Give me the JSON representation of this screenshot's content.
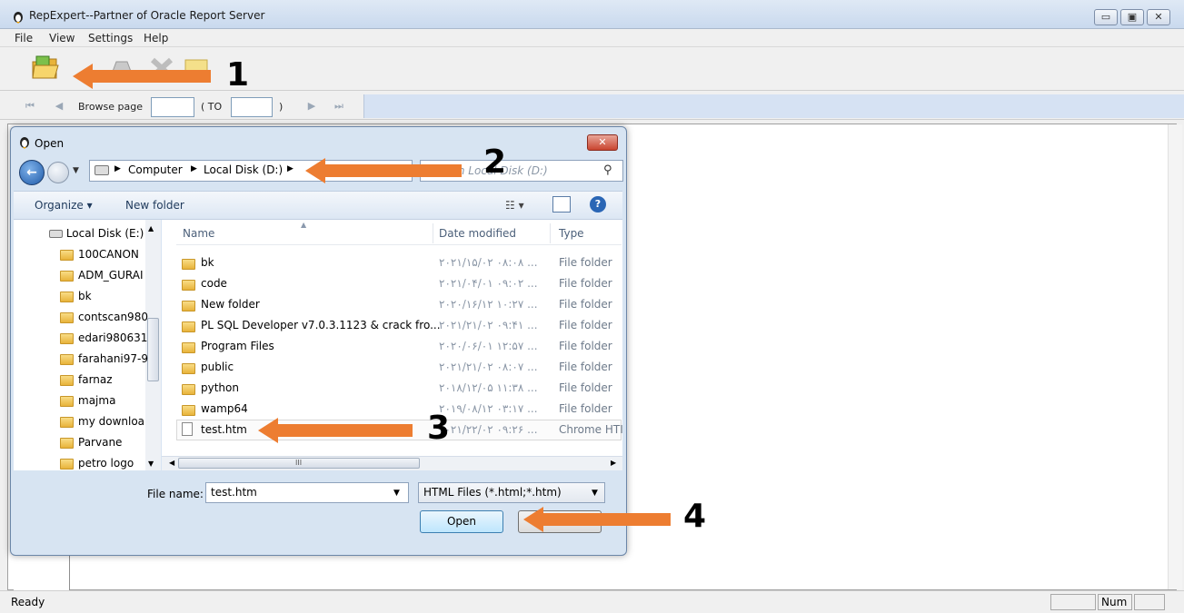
{
  "app": {
    "title": "RepExpert--Partner of Oracle Report Server",
    "window_controls": {
      "minimize": "▭",
      "maximize": "▣",
      "close": "✕"
    }
  },
  "menu": [
    "File",
    "View",
    "Settings",
    "Help"
  ],
  "browse_bar": {
    "label": "Browse page",
    "to_label": "( TO",
    "close_paren": ")"
  },
  "status": {
    "text": "Ready",
    "num": "Num"
  },
  "dialog": {
    "title": "Open",
    "close": "✕",
    "breadcrumb": [
      "Computer",
      "Local Disk (D:)"
    ],
    "search_placeholder": "Search Local Disk (D:)",
    "commands": {
      "organize": "Organize ▾",
      "new_folder": "New folder"
    },
    "nav_items": [
      {
        "label": "Local Disk (E:)",
        "type": "drive"
      },
      {
        "label": "100CANON",
        "type": "folder"
      },
      {
        "label": "ADM_GURAI",
        "type": "folder"
      },
      {
        "label": "bk",
        "type": "folder"
      },
      {
        "label": "contscan980",
        "type": "folder"
      },
      {
        "label": "edari980631",
        "type": "folder"
      },
      {
        "label": "farahani97-9",
        "type": "folder"
      },
      {
        "label": "farnaz",
        "type": "folder"
      },
      {
        "label": "majma",
        "type": "folder"
      },
      {
        "label": "my downloa",
        "type": "folder"
      },
      {
        "label": "Parvane",
        "type": "folder"
      },
      {
        "label": "petro logo",
        "type": "folder"
      }
    ],
    "columns": {
      "name": "Name",
      "date": "Date modified",
      "type": "Type"
    },
    "files": [
      {
        "name": "bk",
        "date": "۲۰۲۱/۱۵/۰۲ ۰۸:۰۸ ...",
        "type": "File folder",
        "kind": "folder"
      },
      {
        "name": "code",
        "date": "۲۰۲۱/۰۴/۰۱ ۰۹:۰۲ ...",
        "type": "File folder",
        "kind": "folder"
      },
      {
        "name": "New folder",
        "date": "۲۰۲۰/۱۶/۱۲ ۱۰:۲۷ ...",
        "type": "File folder",
        "kind": "folder"
      },
      {
        "name": "PL SQL Developer v7.0.3.1123 & crack fro...",
        "date": "۲۰۲۱/۲۱/۰۲ ۰۹:۴۱ ...",
        "type": "File folder",
        "kind": "folder"
      },
      {
        "name": "Program Files",
        "date": "۲۰۲۰/۰۶/۰۱ ۱۲:۵۷ ...",
        "type": "File folder",
        "kind": "folder"
      },
      {
        "name": "public",
        "date": "۲۰۲۱/۲۱/۰۲ ۰۸:۰۷ ...",
        "type": "File folder",
        "kind": "folder"
      },
      {
        "name": "python",
        "date": "۲۰۱۸/۱۲/۰۵ ۱۱:۳۸ ...",
        "type": "File folder",
        "kind": "folder"
      },
      {
        "name": "wamp64",
        "date": "۲۰۱۹/۰۸/۱۲ ۰۳:۱۷ ...",
        "type": "File folder",
        "kind": "folder"
      },
      {
        "name": "test.htm",
        "date": "۲۰۲۱/۲۲/۰۲ ۰۹:۲۶ ...",
        "type": "Chrome HTI",
        "kind": "file"
      }
    ],
    "file_name_label": "File name:",
    "file_name_value": "test.htm",
    "file_type_value": "HTML Files (*.html;*.htm)",
    "open_button": "Open",
    "cancel_button": "Cancel",
    "hscroll_mark": "III"
  },
  "annotations": [
    "1",
    "2",
    "3",
    "4"
  ],
  "colors": {
    "arrow": "#ed7d31",
    "accent": "#1e5aa8"
  }
}
